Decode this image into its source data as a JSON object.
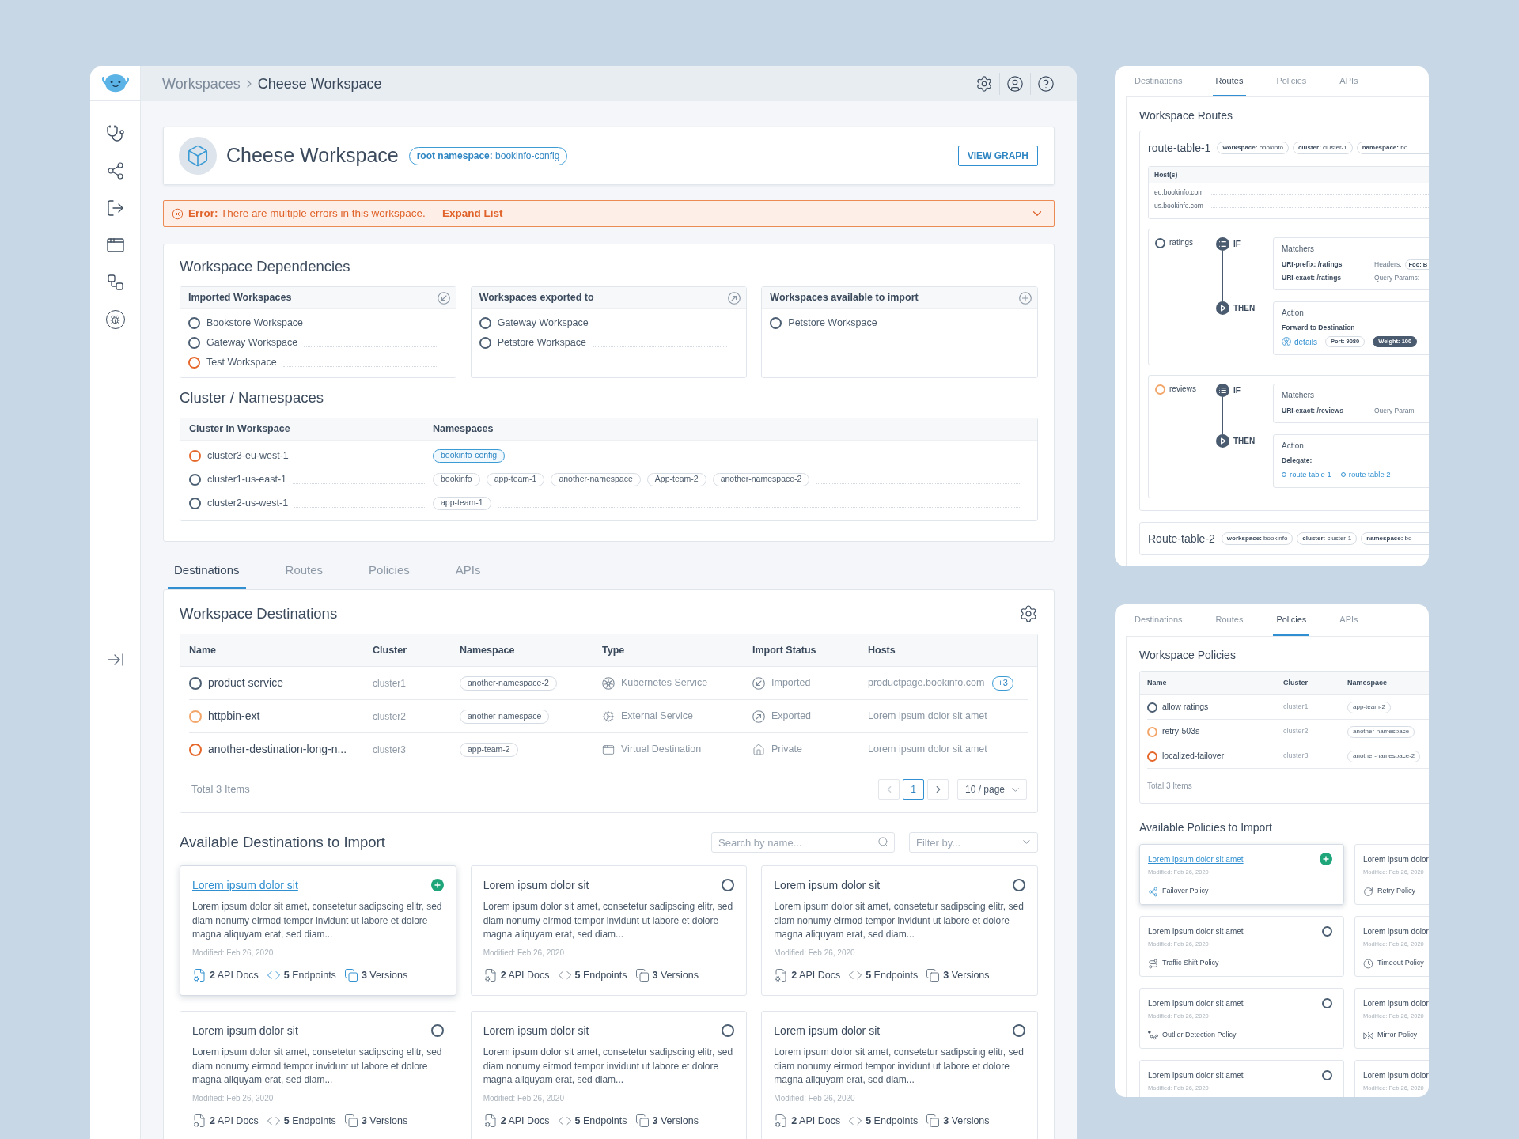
{
  "header": {
    "breadcrumb": [
      {
        "label": "Workspaces",
        "current": false
      },
      {
        "label": "Cheese Workspace",
        "current": true
      }
    ]
  },
  "workspace": {
    "title": "Cheese Workspace",
    "namespace": "**root namespace:** bookinfo-config",
    "button": "VIEW GRAPH"
  },
  "error": {
    "message": "**Error:** There are multiple errors in this workspace.",
    "action": "Expand List",
    "expanded": false
  },
  "dependencies": {
    "title": "Workspace Dependencies",
    "groups": [
      {
        "kind": "imported",
        "title": "Imported Workspaces",
        "items": [
          {
            "name": "Bookstore Workspace",
            "color": "#4d5f73"
          },
          {
            "name": "Gateway Workspace",
            "color": "#4d5f73"
          },
          {
            "name": "Test Workspace",
            "color": "#e5682a"
          }
        ]
      },
      {
        "kind": "exported",
        "title": "Workspaces exported to",
        "items": [
          {
            "name": "Gateway Workspace",
            "color": "#4d5f73"
          },
          {
            "name": "Petstore Workspace",
            "color": "#4d5f73"
          }
        ]
      },
      {
        "kind": "available",
        "title": "Workspaces available to import",
        "items": [
          {
            "name": "Petstore Workspace",
            "color": "#4d5f73"
          }
        ]
      }
    ]
  },
  "clusters": {
    "title": "Cluster / Namespaces",
    "columns": [
      "Cluster in Workspace",
      "Namespaces"
    ],
    "rows": [
      {
        "name": "cluster3-eu-west-1",
        "color": "#e5682a",
        "namespaces": [
          {
            "name": "bookinfo-config",
            "root": true
          }
        ]
      },
      {
        "name": "cluster1-us-east-1",
        "color": "#4d5f73",
        "namespaces": [
          {
            "name": "bookinfo",
            "root": false
          },
          {
            "name": "app-team-1",
            "root": false
          },
          {
            "name": "another-namespace",
            "root": false
          },
          {
            "name": "App-team-2",
            "root": false
          },
          {
            "name": "another-namespace-2",
            "root": false
          }
        ]
      },
      {
        "name": "cluster2-us-west-1",
        "color": "#4d5f73",
        "namespaces": [
          {
            "name": "app-team-1",
            "root": false
          }
        ]
      }
    ]
  },
  "tabs": [
    {
      "label": "Destinations",
      "selected": true
    },
    {
      "label": "Routes",
      "selected": false
    },
    {
      "label": "Policies",
      "selected": false
    },
    {
      "label": "APIs",
      "selected": false
    }
  ],
  "destinations": {
    "title": "Workspace Destinations",
    "columns": [
      "Name",
      "Cluster",
      "Namespace",
      "Type",
      "Import Status",
      "Hosts"
    ],
    "rows": [
      {
        "name": "product service",
        "color": "#4d5f73",
        "cluster": "cluster1",
        "namespace": "another-namespace-2",
        "type": {
          "kind": "kubernetes",
          "label": "Kubernetes Service"
        },
        "status": {
          "kind": "imported",
          "label": "Imported"
        },
        "hosts": "productpage.bookinfo.com",
        "more": "+3"
      },
      {
        "name": "httpbin-ext",
        "color": "#f2a66a",
        "cluster": "cluster2",
        "namespace": "another-namespace",
        "type": {
          "kind": "external",
          "label": "External Service"
        },
        "status": {
          "kind": "exported",
          "label": "Exported"
        },
        "hosts": "Lorem ipsum dolor sit amet"
      },
      {
        "name": "another-destination-long-n...",
        "color": "#e5682a",
        "cluster": "cluster3",
        "namespace": "app-team-2",
        "type": {
          "kind": "virtual",
          "label": "Virtual Destination"
        },
        "status": {
          "kind": "private",
          "label": "Private"
        },
        "hosts": "Lorem ipsum dolor sit amet"
      }
    ],
    "total": "Total 3 Items",
    "pages": [
      {
        "label": "1",
        "selected": true
      }
    ],
    "page_size": "10 / page"
  },
  "available": {
    "title": "Available Destinations to Import",
    "search_placeholder": "Search by name...",
    "filter_placeholder": "Filter by...",
    "cards": [
      {
        "title": "Lorem ipsum dolor sit",
        "selected": true,
        "description": "Lorem ipsum dolor sit amet, consetetur sadipscing elitr, sed diam nonumy eirmod tempor invidunt ut labore et dolore magna aliquyam erat, sed diam...",
        "modified": "Modified: Feb 26, 2020",
        "stats": [
          {
            "kind": "docs",
            "text": "**2** API Docs"
          },
          {
            "kind": "endpoints",
            "text": "**5** Endpoints"
          },
          {
            "kind": "versions",
            "text": "**3** Versions"
          }
        ]
      },
      {
        "title": "Lorem ipsum dolor sit",
        "selected": false,
        "description": "Lorem ipsum dolor sit amet, consetetur sadipscing elitr, sed diam nonumy eirmod tempor invidunt ut labore et dolore magna aliquyam erat, sed diam...",
        "modified": "Modified: Feb 26, 2020",
        "stats": [
          {
            "kind": "docs",
            "text": "**2** API Docs"
          },
          {
            "kind": "endpoints",
            "text": "**5** Endpoints"
          },
          {
            "kind": "versions",
            "text": "**3** Versions"
          }
        ]
      },
      {
        "title": "Lorem ipsum dolor sit",
        "selected": false,
        "description": "Lorem ipsum dolor sit amet, consetetur sadipscing elitr, sed diam nonumy eirmod tempor invidunt ut labore et dolore magna aliquyam erat, sed diam...",
        "modified": "Modified: Feb 26, 2020",
        "stats": [
          {
            "kind": "docs",
            "text": "**2** API Docs"
          },
          {
            "kind": "endpoints",
            "text": "**5** Endpoints"
          },
          {
            "kind": "versions",
            "text": "**3** Versions"
          }
        ]
      },
      {
        "title": "Lorem ipsum dolor sit",
        "selected": false,
        "description": "Lorem ipsum dolor sit amet, consetetur sadipscing elitr, sed diam nonumy eirmod tempor invidunt ut labore et dolore magna aliquyam erat, sed diam...",
        "modified": "Modified: Feb 26, 2020",
        "stats": [
          {
            "kind": "docs",
            "text": "**2** API Docs"
          },
          {
            "kind": "endpoints",
            "text": "**5** Endpoints"
          },
          {
            "kind": "versions",
            "text": "**3** Versions"
          }
        ]
      },
      {
        "title": "Lorem ipsum dolor sit",
        "selected": false,
        "description": "Lorem ipsum dolor sit amet, consetetur sadipscing elitr, sed diam nonumy eirmod tempor invidunt ut labore et dolore magna aliquyam erat, sed diam...",
        "modified": "Modified: Feb 26, 2020",
        "stats": [
          {
            "kind": "docs",
            "text": "**2** API Docs"
          },
          {
            "kind": "endpoints",
            "text": "**5** Endpoints"
          },
          {
            "kind": "versions",
            "text": "**3** Versions"
          }
        ]
      },
      {
        "title": "Lorem ipsum dolor sit",
        "selected": false,
        "description": "Lorem ipsum dolor sit amet, consetetur sadipscing elitr, sed diam nonumy eirmod tempor invidunt ut labore et dolore magna aliquyam erat, sed diam...",
        "modified": "Modified: Feb 26, 2020",
        "stats": [
          {
            "kind": "docs",
            "text": "**2** API Docs"
          },
          {
            "kind": "endpoints",
            "text": "**5** Endpoints"
          },
          {
            "kind": "versions",
            "text": "**3** Versions"
          }
        ]
      }
    ]
  },
  "routes_panel": {
    "tabs": [
      {
        "label": "Destinations",
        "selected": false
      },
      {
        "label": "Routes",
        "selected": true
      },
      {
        "label": "Policies",
        "selected": false
      },
      {
        "label": "APIs",
        "selected": false
      }
    ],
    "title": "Workspace Routes",
    "tables": [
      {
        "name": "route-table-1",
        "tags": [
          "**workspace:** bookinfo",
          "**cluster:** cluster-1",
          "**namespace:** bo"
        ],
        "hosts": {
          "title": "Host(s)",
          "items": [
            "eu.bookinfo.com",
            "us.bookinfo.com"
          ]
        },
        "routes": [
          {
            "name": "ratings",
            "color": "#4d5f73",
            "if_label": "IF",
            "then_label": "THEN",
            "matchers": {
              "title": "Matchers",
              "rules": [
                "URI-prefix: /ratings",
                "URI-exact: /ratings"
              ],
              "extras": [
                {
                  "label": "Headers:",
                  "tag": "Foo: B"
                },
                {
                  "label": "Query Params:"
                }
              ]
            },
            "action": {
              "title": "Action",
              "kind": "forward",
              "heading": "Forward to Destination",
              "destination": "details",
              "tags": [
                {
                  "text": "Port: 9080",
                  "filled": false
                },
                {
                  "text": "Weight: 100",
                  "filled": true
                }
              ]
            }
          },
          {
            "name": "reviews",
            "color": "#f2a66a",
            "if_label": "IF",
            "then_label": "THEN",
            "matchers": {
              "title": "Matchers",
              "rules": [
                "URI-exact: /reviews"
              ],
              "extras": [
                {
                  "label": "Query Param"
                }
              ]
            },
            "action": {
              "title": "Action",
              "kind": "delegate",
              "heading": "Delegate:",
              "links": [
                "route table 1",
                "route table 2"
              ]
            }
          }
        ]
      },
      {
        "name": "Route-table-2",
        "tags": [
          "**workspace:** bookinfo",
          "**cluster:** cluster-1",
          "**namespace:** bo"
        ]
      }
    ]
  },
  "policies_panel": {
    "tabs": [
      {
        "label": "Destinations",
        "selected": false
      },
      {
        "label": "Routes",
        "selected": false
      },
      {
        "label": "Policies",
        "selected": true
      },
      {
        "label": "APIs",
        "selected": false
      }
    ],
    "title": "Workspace Policies",
    "columns": [
      "Name",
      "Cluster",
      "Namespace"
    ],
    "rows": [
      {
        "name": "allow ratings",
        "color": "#4d5f73",
        "cluster": "cluster1",
        "namespace": "app-team-2"
      },
      {
        "name": "retry-503s",
        "color": "#f2a66a",
        "cluster": "cluster2",
        "namespace": "another-namespace"
      },
      {
        "name": "localized-failover",
        "color": "#e5682a",
        "cluster": "cluster3",
        "namespace": "another-namespace-2"
      }
    ],
    "total": "Total 3 Items",
    "import_title": "Available Policies to Import",
    "cards": [
      {
        "title": "Lorem ipsum dolor sit amet",
        "selected": true,
        "modified": "Modified: Feb 26, 2020",
        "policy": {
          "kind": "failover",
          "label": "Failover Policy"
        }
      },
      {
        "title": "Lorem ipsum dolor",
        "modified": "Modified: Feb 26, 2020",
        "policy": {
          "kind": "retry",
          "label": "Retry Policy"
        }
      },
      {
        "title": "Lorem ipsum dolor sit amet",
        "selected": false,
        "modified": "Modified: Feb 26, 2020",
        "policy": {
          "kind": "traffic",
          "label": "Traffic Shift Policy"
        }
      },
      {
        "title": "Lorem ipsum dolor",
        "modified": "Modified: Feb 26, 2020",
        "policy": {
          "kind": "timeout",
          "label": "Timeout Policy"
        }
      },
      {
        "title": "Lorem ipsum dolor sit amet",
        "selected": false,
        "modified": "Modified: Feb 26, 2020",
        "policy": {
          "kind": "outlier",
          "label": "Outlier Detection Policy"
        }
      },
      {
        "title": "Lorem ipsum dolor",
        "modified": "Modified: Feb 26, 2020",
        "policy": {
          "kind": "mirror",
          "label": "Mirror Policy"
        }
      },
      {
        "title": "Lorem ipsum dolor sit amet",
        "selected": false,
        "modified": "Modified: Feb 26, 2020"
      },
      {
        "title": "Lorem ipsum dolor",
        "modified": "Modified: Feb 26, 2020"
      }
    ]
  }
}
